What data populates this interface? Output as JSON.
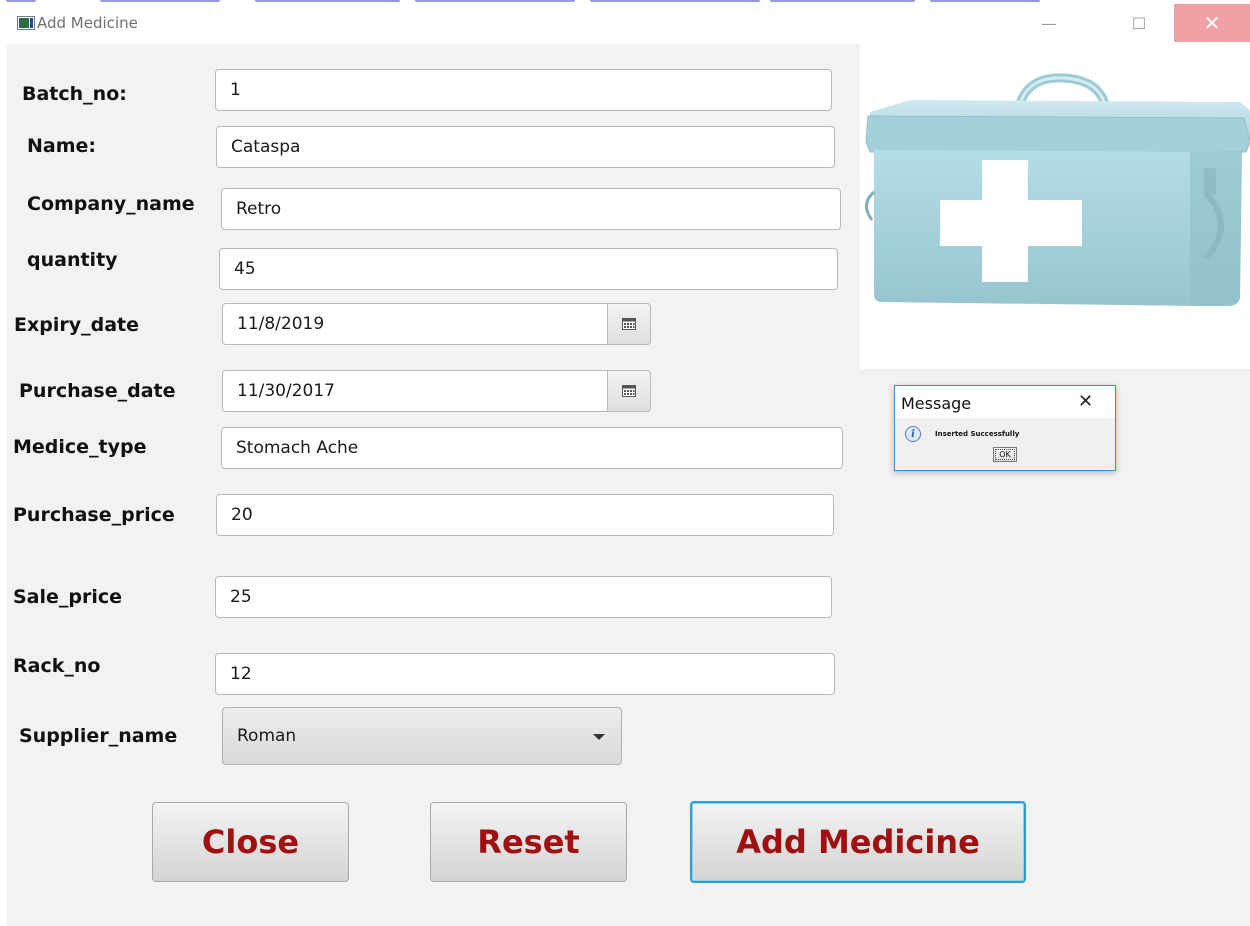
{
  "window": {
    "title": "Add Medicine",
    "minimize_glyph": "—",
    "maximize_glyph": "☐",
    "close_glyph": "✕"
  },
  "form": {
    "batch_no": {
      "label": "Batch_no:",
      "value": "1"
    },
    "name": {
      "label": "Name:",
      "value": "Cataspa"
    },
    "company_name": {
      "label": "Company_name",
      "value": "Retro"
    },
    "quantity": {
      "label": "quantity",
      "value": "45"
    },
    "expiry_date": {
      "label": "Expiry_date",
      "value": "11/8/2019"
    },
    "purchase_date": {
      "label": "Purchase_date",
      "value": "11/30/2017"
    },
    "medice_type": {
      "label": "Medice_type",
      "value": "Stomach Ache"
    },
    "purchase_price": {
      "label": "Purchase_price",
      "value": "20"
    },
    "sale_price": {
      "label": "Sale_price",
      "value": "25"
    },
    "rack_no": {
      "label": "Rack_no",
      "value": "12"
    },
    "supplier_name": {
      "label": "Supplier_name",
      "value": "Roman"
    }
  },
  "buttons": {
    "close": "Close",
    "reset": "Reset",
    "add": "Add Medicine"
  },
  "dialog": {
    "title": "Message",
    "close_glyph": "✕",
    "info_glyph": "i",
    "text": "Inserted Successfully",
    "ok": "OK"
  },
  "icons": {
    "calendar": "calendar-icon",
    "dropdown": "chevron-down-icon",
    "image": "first-aid-box"
  },
  "colors": {
    "button_text": "#a01010",
    "focus_border": "#2a9fd8",
    "close_hover": "#f2a0a6",
    "box_color": "#a9d3dc"
  }
}
